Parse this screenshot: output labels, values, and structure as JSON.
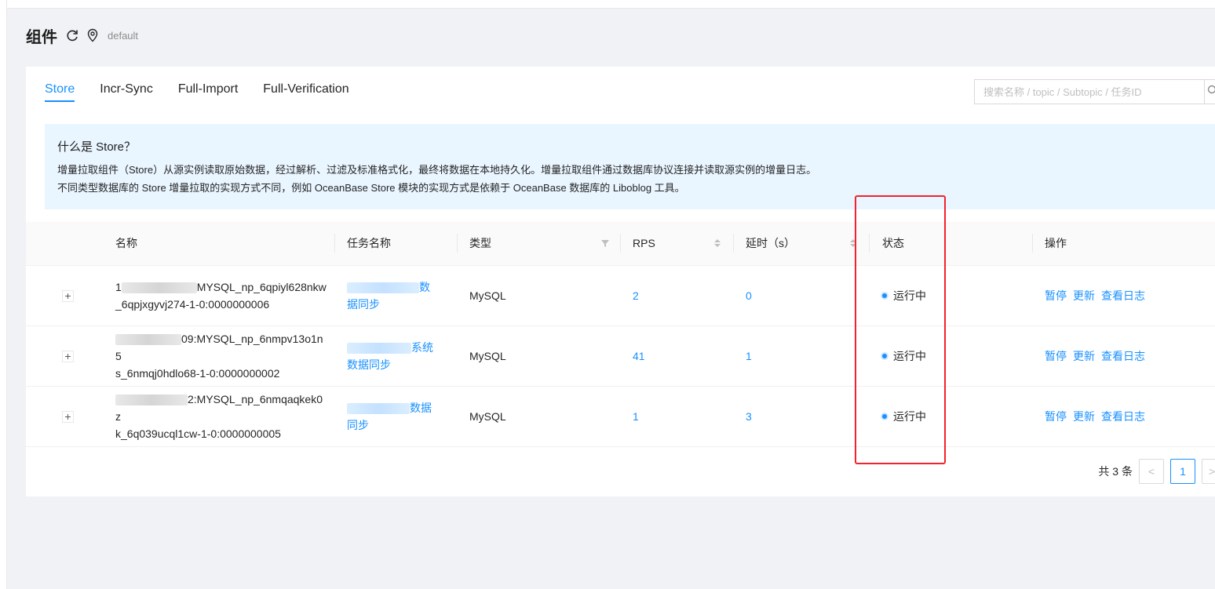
{
  "header": {
    "title": "组件",
    "namespace": "default"
  },
  "tabs": [
    {
      "label": "Store",
      "active": true
    },
    {
      "label": "Incr-Sync",
      "active": false
    },
    {
      "label": "Full-Import",
      "active": false
    },
    {
      "label": "Full-Verification",
      "active": false
    }
  ],
  "search": {
    "placeholder": "搜索名称 / topic / Subtopic / 任务ID",
    "value": ""
  },
  "info": {
    "title": "什么是 Store？",
    "line1": "增量拉取组件（Store）从源实例读取原始数据，经过解析、过滤及标准格式化，最终将数据在本地持久化。增量拉取组件通过数据库协议连接并读取源实例的增量日志。",
    "line2": "不同类型数据库的 Store 增量拉取的实现方式不同，例如 OceanBase Store 模块的实现方式是依赖于 OceanBase 数据库的 Liboblog 工具。"
  },
  "table": {
    "columns": {
      "name": "名称",
      "task": "任务名称",
      "type": "类型",
      "rps": "RPS",
      "delay": "延时（s）",
      "status": "状态",
      "ops": "操作"
    },
    "rows": [
      {
        "expand": "+",
        "name_prefix": "1",
        "name_line1": "MYSQL_np_6qpiyl628nkw",
        "name_line2": "_6qpjxgyvj274-1-0:0000000006",
        "task_suffix1": "数",
        "task_line2": "据同步",
        "type": "MySQL",
        "rps": "2",
        "delay": "0",
        "status": "运行中",
        "ops": [
          "暂停",
          "更新",
          "查看日志"
        ]
      },
      {
        "expand": "+",
        "name_prefix": "",
        "name_line1": "09:MYSQL_np_6nmpv13o1n5",
        "name_line2": "s_6nmqj0hdlo68-1-0:0000000002",
        "task_suffix1": "系统",
        "task_line2": "数据同步",
        "type": "MySQL",
        "rps": "41",
        "delay": "1",
        "status": "运行中",
        "ops": [
          "暂停",
          "更新",
          "查看日志"
        ]
      },
      {
        "expand": "+",
        "name_prefix": "",
        "name_line1": "2:MYSQL_np_6nmqaqkek0z",
        "name_line2": "k_6q039ucql1cw-1-0:0000000005",
        "task_suffix1": "数据",
        "task_line2": "同步",
        "type": "MySQL",
        "rps": "1",
        "delay": "3",
        "status": "运行中",
        "ops": [
          "暂停",
          "更新",
          "查看日志"
        ]
      }
    ]
  },
  "pagination": {
    "total_text": "共 3 条",
    "prev": "<",
    "current_page": "1",
    "next": ">"
  },
  "colors": {
    "primary": "#1890ff",
    "highlight": "#f5222d",
    "info_bg": "#e9f5ff"
  }
}
